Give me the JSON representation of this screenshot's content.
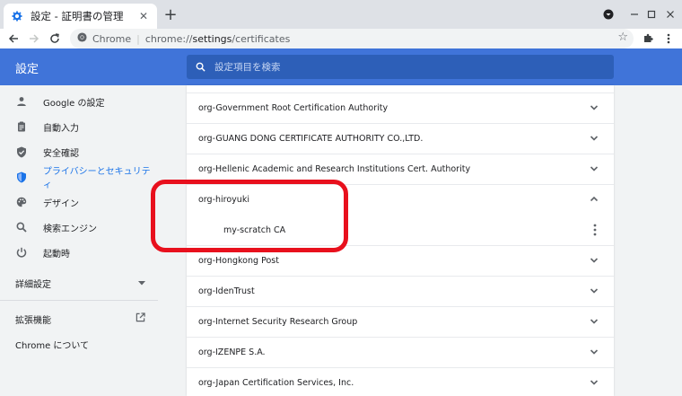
{
  "browser": {
    "tab_title": "設定 - 証明書の管理",
    "omnibox": {
      "chip": "Chrome",
      "url_scheme": "chrome://",
      "url_host": "settings",
      "url_path": "/certificates"
    }
  },
  "settings": {
    "title": "設定",
    "search_placeholder": "設定項目を検索"
  },
  "sidebar": {
    "items": [
      {
        "label": "Google の設定",
        "icon": "person-icon"
      },
      {
        "label": "自動入力",
        "icon": "clipboard-icon"
      },
      {
        "label": "安全確認",
        "icon": "shield-check-icon"
      },
      {
        "label": "プライバシーとセキュリティ",
        "icon": "shield-icon",
        "active": true
      },
      {
        "label": "デザイン",
        "icon": "palette-icon"
      },
      {
        "label": "検索エンジン",
        "icon": "search-icon"
      },
      {
        "label": "起動時",
        "icon": "power-icon"
      }
    ],
    "advanced": "詳細設定",
    "extensions": "拡張機能",
    "about": "Chrome について"
  },
  "certificates": {
    "rows": [
      {
        "label": "org-Government Root Certification Authority",
        "expanded": false
      },
      {
        "label": "org-GUANG DONG CERTIFICATE AUTHORITY CO.,LTD.",
        "expanded": false
      },
      {
        "label": "org-Hellenic Academic and Research Institutions Cert. Authority",
        "expanded": false
      },
      {
        "label": "org-hiroyuki",
        "expanded": true
      },
      {
        "label": "my-scratch CA",
        "child": true
      },
      {
        "label": "org-Hongkong Post",
        "expanded": false
      },
      {
        "label": "org-IdenTrust",
        "expanded": false
      },
      {
        "label": "org-Internet Security Research Group",
        "expanded": false
      },
      {
        "label": "org-IZENPE S.A.",
        "expanded": false
      },
      {
        "label": "org-Japan Certification Services, Inc.",
        "expanded": false
      }
    ]
  },
  "colors": {
    "accent": "#1a73e8",
    "header": "#4074d9",
    "annotation": "#e8101d"
  }
}
